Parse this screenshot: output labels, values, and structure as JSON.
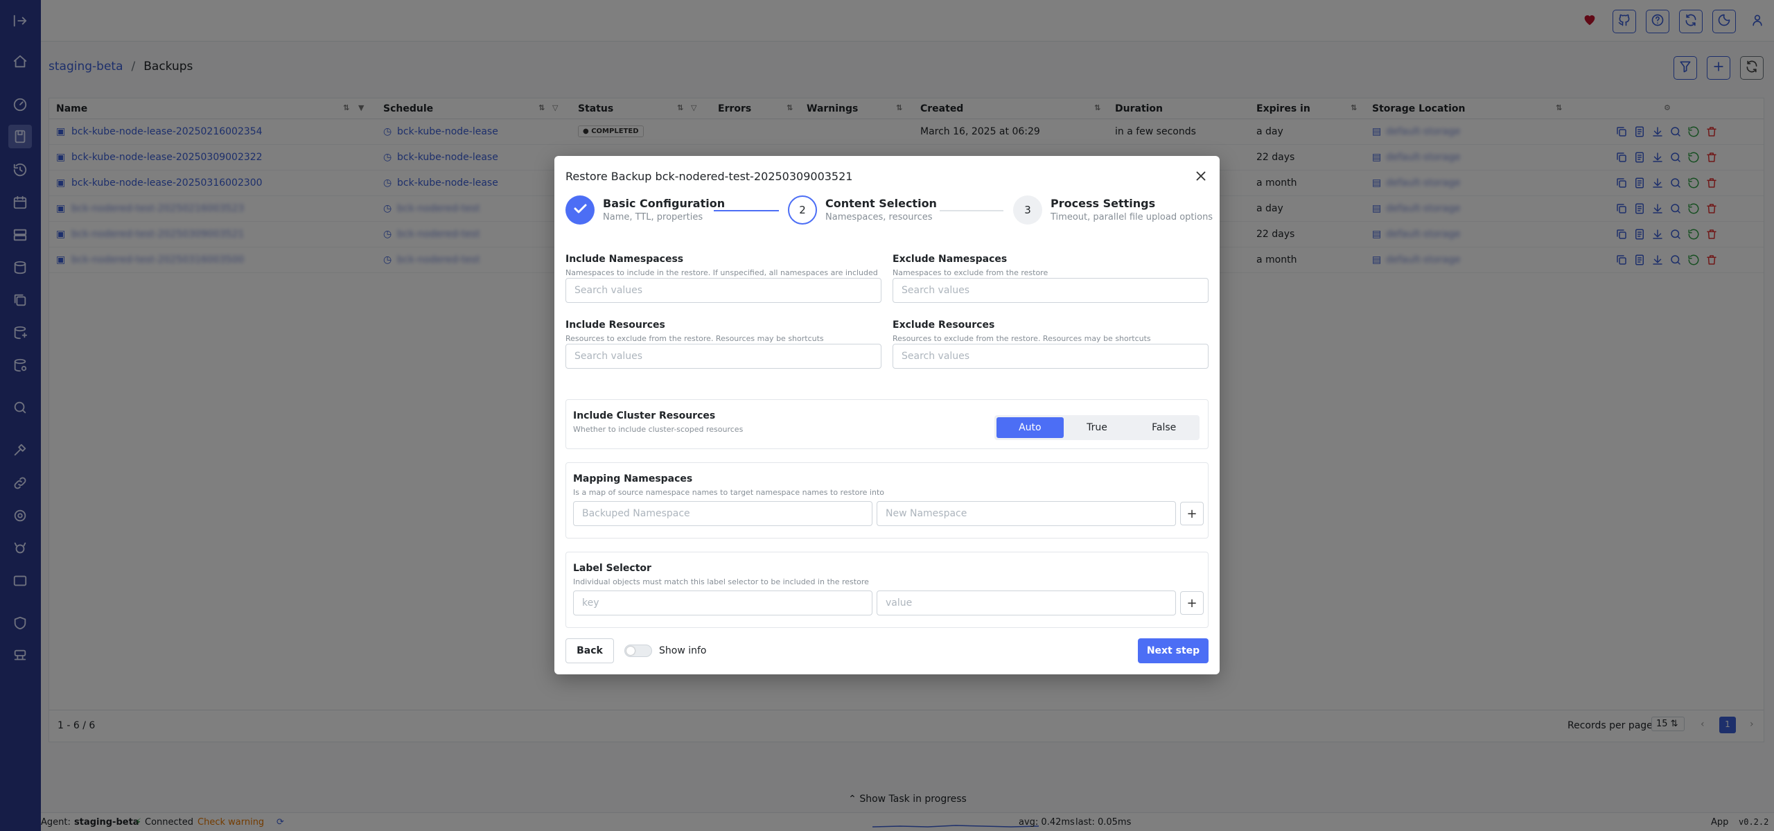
{
  "colors": {
    "sidebar": "#2c3a8f",
    "accent": "#4c6ef5",
    "link": "#3b5fd6",
    "danger": "#c0122d"
  },
  "breadcrumb": {
    "cluster": "staging-beta",
    "separator": "/",
    "page": "Backups"
  },
  "table": {
    "headers": {
      "name": "Name",
      "schedule": "Schedule",
      "status": "Status",
      "errors": "Errors",
      "warnings": "Warnings",
      "created": "Created",
      "duration": "Duration",
      "expires": "Expires in",
      "storage": "Storage Location"
    },
    "rows": [
      {
        "name": "bck-kube-node-lease-20250216002354",
        "schedule": "bck-kube-node-lease",
        "status": "COMPLETED",
        "created": "March 16, 2025 at 06:29",
        "duration": "in a few seconds",
        "expires": "a day",
        "storage": "default-storage"
      },
      {
        "name": "bck-kube-node-lease-20250309002322",
        "schedule": "bck-kube-node-lease",
        "status": "",
        "created": "",
        "duration": "",
        "expires": "22 days",
        "storage": "default-storage"
      },
      {
        "name": "bck-kube-node-lease-20250316002300",
        "schedule": "bck-kube-node-lease",
        "status": "",
        "created": "",
        "duration": "",
        "expires": "a month",
        "storage": "default-storage"
      },
      {
        "name": "bck-nodered-test-20250216003523",
        "schedule": "bck-nodered-test",
        "status": "",
        "created": "",
        "duration": "",
        "expires": "a day",
        "storage": "default-storage"
      },
      {
        "name": "bck-nodered-test-20250309003521",
        "schedule": "bck-nodered-test",
        "status": "",
        "created": "",
        "duration": "",
        "expires": "22 days",
        "storage": "default-storage"
      },
      {
        "name": "bck-nodered-test-20250316003500",
        "schedule": "bck-nodered-test",
        "status": "",
        "created": "",
        "duration": "",
        "expires": "a month",
        "storage": "default-storage"
      }
    ],
    "footer": {
      "range": "1 - 6 / 6",
      "records_label": "Records per page",
      "per_page": "15",
      "page": "1"
    }
  },
  "task_bar": {
    "label": "Show Task in progress"
  },
  "statusbar": {
    "agent_label": "Agent:",
    "agent": "staging-beta",
    "connected": "Connected",
    "check": "Check warning",
    "avg": "avg: 0.42ms",
    "last": "last: 0.05ms",
    "app": "App",
    "version": "v0.2.2"
  },
  "modal": {
    "title": "Restore Backup bck-nodered-test-20250309003521",
    "steps": [
      {
        "num": "",
        "title": "Basic Configuration",
        "desc": "Name, TTL, properties"
      },
      {
        "num": "2",
        "title": "Content Selection",
        "desc": "Namespaces, resources"
      },
      {
        "num": "3",
        "title": "Process Settings",
        "desc": "Timeout, parallel file upload options"
      }
    ],
    "include_ns": {
      "label": "Include Namespacess",
      "desc": "Namespaces to include in the restore. If unspecified, all namespaces are included",
      "placeholder": "Search values"
    },
    "exclude_ns": {
      "label": "Exclude Namespaces",
      "desc": "Namespaces to exclude from the restore",
      "placeholder": "Search values"
    },
    "include_res": {
      "label": "Include Resources",
      "desc": "Resources to exclude from the restore. Resources may be shortcuts",
      "placeholder": "Search values"
    },
    "exclude_res": {
      "label": "Exclude Resources",
      "desc": "Resources to exclude from the restore. Resources may be shortcuts",
      "placeholder": "Search values"
    },
    "cluster_res": {
      "label": "Include Cluster Resources",
      "desc": "Whether to include cluster-scoped resources",
      "options": [
        "Auto",
        "True",
        "False"
      ],
      "selected": "Auto"
    },
    "mapping": {
      "label": "Mapping Namespaces",
      "desc": "Is a map of source namespace names to target namespace names to restore into",
      "src_placeholder": "Backuped Namespace",
      "dst_placeholder": "New Namespace"
    },
    "label_sel": {
      "label": "Label Selector",
      "desc": "Individual objects must match this label selector to be included in the restore",
      "key_placeholder": "key",
      "value_placeholder": "value"
    },
    "back": "Back",
    "show_info": "Show info",
    "next": "Next step"
  }
}
